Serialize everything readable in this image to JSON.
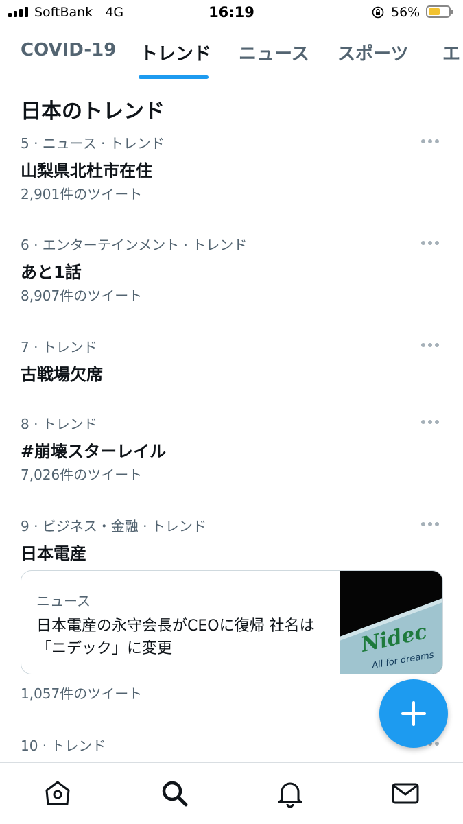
{
  "status_bar": {
    "carrier": "SoftBank",
    "network": "4G",
    "time": "16:19",
    "battery_percent": "56%",
    "battery_level": 0.56,
    "battery_color": "#f2c230"
  },
  "tabs": [
    {
      "label": "COVID-19",
      "active": false
    },
    {
      "label": "トレンド",
      "active": true
    },
    {
      "label": "ニュース",
      "active": false
    },
    {
      "label": "スポーツ",
      "active": false
    },
    {
      "label": "エ",
      "active": false
    }
  ],
  "accent_color": "#1d9bf0",
  "page_title": "日本のトレンド",
  "trends": [
    {
      "meta": "5 · ニュース · トレンド",
      "name": "山梨県北杜市在住",
      "count": "2,901件のツイート"
    },
    {
      "meta": "6 · エンターテインメント · トレンド",
      "name": "あと1話",
      "count": "8,907件のツイート"
    },
    {
      "meta": "7 · トレンド",
      "name": "古戦場欠席",
      "count": ""
    },
    {
      "meta": "8 · トレンド",
      "name": "#崩壊スターレイル",
      "count": "7,026件のツイート"
    },
    {
      "meta": "9 · ビジネス・金融 · トレンド",
      "name": "日本電産",
      "count": "1,057件のツイート",
      "card": {
        "category": "ニュース",
        "title": "日本電産の永守会長がCEOに復帰 社名は「ニデック」に変更",
        "image_brand": "Nidec",
        "image_tagline": "All for dreams"
      }
    },
    {
      "meta": "10 · トレンド",
      "name": "",
      "count": ""
    }
  ],
  "icons": {
    "more": "more-horizontal-icon",
    "compose": "plus-icon",
    "home": "home-icon",
    "search": "search-icon",
    "notifications": "bell-icon",
    "messages": "mail-icon"
  }
}
